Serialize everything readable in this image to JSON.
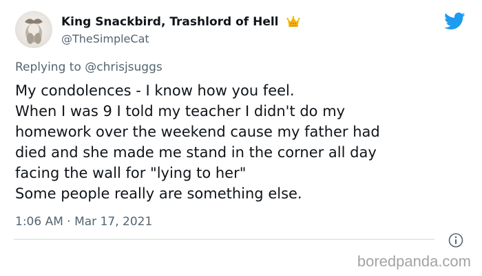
{
  "tweet": {
    "display_name": "King Snackbird, Trashlord of Hell",
    "handle": "@TheSimpleCat",
    "replying_to_label": "Replying to",
    "replying_to_handle": "@chrisjsuggs",
    "body_lines": [
      "My condolences - I know how you feel.",
      "When I was 9 I told my teacher I didn't do my",
      "homework over the weekend cause my father had",
      "died and she made me stand in the corner all day",
      "facing the wall for \"lying to her\"",
      "Some people really are something else."
    ],
    "timestamp": "1:06 AM · Mar 17, 2021"
  },
  "watermark": "boredpanda.com",
  "icons": {
    "brand": "twitter-bird-icon",
    "name_decoration": "crown-icon",
    "info": "info-icon"
  },
  "colors": {
    "twitter_blue": "#1d9bf0",
    "secondary_text": "#536471",
    "primary_text": "#0f1419",
    "crown": "#f5b301",
    "watermark": "#a3a3a3"
  }
}
